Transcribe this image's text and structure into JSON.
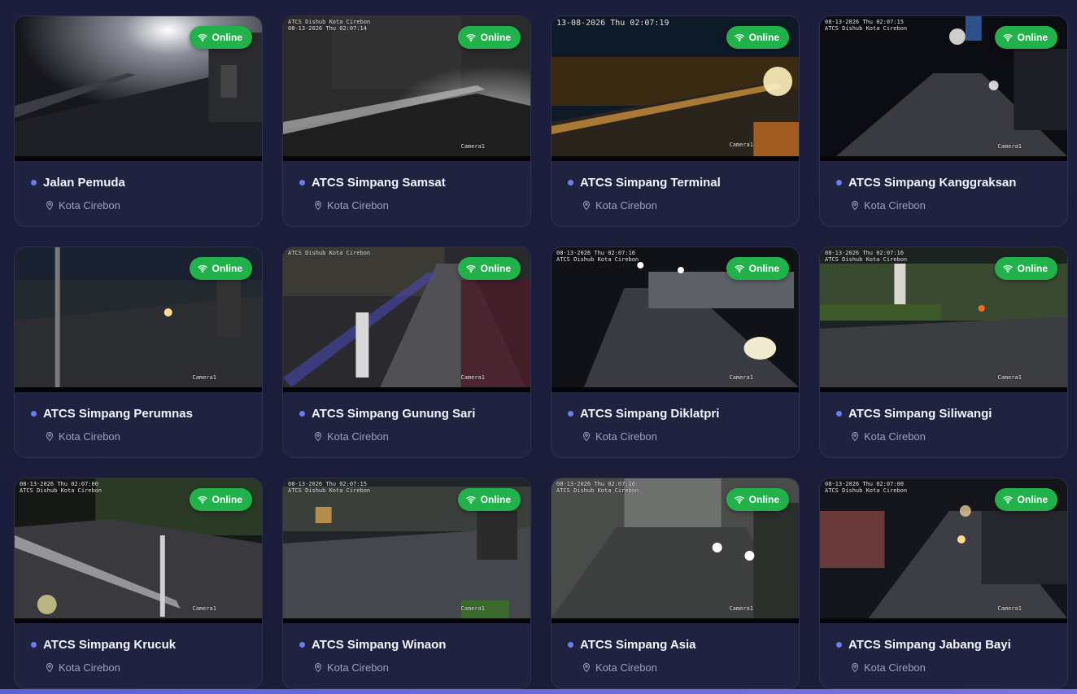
{
  "status_label": "Online",
  "cameras": [
    {
      "title": "Jalan Pemuda",
      "location": "Kota Cirebon",
      "osd_top": "",
      "osd_cam": ""
    },
    {
      "title": "ATCS Simpang Samsat",
      "location": "Kota Cirebon",
      "osd_top": "ATCS Dishub Kota Cirebon\n08-13-2026 Thu 02:07:14",
      "osd_cam": "Camera1"
    },
    {
      "title": "ATCS Simpang Terminal",
      "location": "Kota Cirebon",
      "osd_top": "13-08-2026 Thu 02:07:19",
      "osd_cam": "Camera1"
    },
    {
      "title": "ATCS Simpang Kanggraksan",
      "location": "Kota Cirebon",
      "osd_top": "08-13-2026 Thu 02:07:15\nATCS Dishub Kota Cirebon",
      "osd_cam": "Camera1"
    },
    {
      "title": "ATCS Simpang Perumnas",
      "location": "Kota Cirebon",
      "osd_top": "",
      "osd_cam": "Camera1"
    },
    {
      "title": "ATCS Simpang Gunung Sari",
      "location": "Kota Cirebon",
      "osd_top": "ATCS Dishub Kota Cirebon",
      "osd_cam": "Camera1"
    },
    {
      "title": "ATCS Simpang Diklatpri",
      "location": "Kota Cirebon",
      "osd_top": "08-13-2026 Thu 02:07:16\nATCS Dishub Kota Cirebon",
      "osd_cam": "Camera1"
    },
    {
      "title": "ATCS Simpang Siliwangi",
      "location": "Kota Cirebon",
      "osd_top": "08-13-2026 Thu 02:07:16\nATCS Dishub Kota Cirebon",
      "osd_cam": "Camera1"
    },
    {
      "title": "ATCS Simpang Krucuk",
      "location": "Kota Cirebon",
      "osd_top": "08-13-2026 Thu 02:07:00\nATCS Dishub Kota Cirebon",
      "osd_cam": "Camera1"
    },
    {
      "title": "ATCS Simpang Winaon",
      "location": "Kota Cirebon",
      "osd_top": "08-13-2026 Thu 02:07:15\nATCS Dishub Kota Cirebon",
      "osd_cam": "Camera1"
    },
    {
      "title": "ATCS Simpang Asia",
      "location": "Kota Cirebon",
      "osd_top": "08-13-2026 Thu 02:07:16\nATCS Dishub Kota Cirebon",
      "osd_cam": "Camera1"
    },
    {
      "title": "ATCS Simpang Jabang Bayi",
      "location": "Kota Cirebon",
      "osd_top": "08-13-2026 Thu 02:07:00\nATCS Dishub Kota Cirebon",
      "osd_cam": "Camera1"
    }
  ],
  "colors": {
    "page_bg": "#1b1d3a",
    "card_bg": "#20233f",
    "online_green": "#22b24c",
    "accent_dot": "#6b7cf0",
    "title_text": "#f3f4fb",
    "location_text": "#9ba0bd"
  },
  "icons": {
    "status": "wifi-icon",
    "location": "map-pin-icon",
    "bullet": "dot-icon"
  }
}
